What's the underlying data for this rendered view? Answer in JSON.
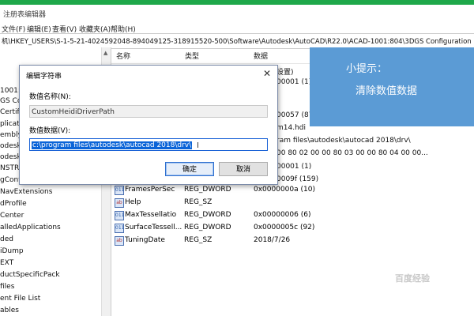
{
  "window": {
    "title": "注册表编辑器"
  },
  "menu": [
    "文件(F)",
    "编辑(E)",
    "查看(V)",
    "收藏夹(A)",
    "帮助(H)"
  ],
  "address": "机\\HKEY_USERS\\S-1-5-21-4024592048-894049125-318915520-500\\Software\\Autodesk\\AutoCAD\\R22.0\\ACAD-1001:804\\3DGS Configuration",
  "tree_items": [
    "1001:8",
    "GS Con",
    "Certific",
    "plicatio",
    "embly",
    "odeskA",
    "odeskS",
    "NSTRA",
    "gConve",
    "NavExtensions",
    "dProfile",
    "Center",
    "alledApplications",
    "ded",
    "iDump",
    "EXT",
    "ductSpecificPack",
    "files",
    "ent File List",
    "ables"
  ],
  "columns": {
    "name": "名称",
    "type": "类型",
    "data": "数据"
  },
  "peek_values": [
    "设置)",
    "00001 (1)",
    "00057 (87)",
    "m14.hdi",
    "ram files\\autodesk\\autocad 2018\\drv\\",
    "00 80 02 00 00 80 03 00 00 80 04 00 00...",
    "00001 (1)",
    "0009f (159)",
    "0000000a (10)"
  ],
  "rows": [
    {
      "icon": "dword-icon",
      "name": "FramesPerSec",
      "type": "REG_DWORD",
      "data": "0x0000000a (10)"
    },
    {
      "icon": "string-icon",
      "name": "Help",
      "type": "REG_SZ",
      "data": ""
    },
    {
      "icon": "dword-icon",
      "name": "MaxTessellatio",
      "type": "REG_DWORD",
      "data": "0x00000006 (6)"
    },
    {
      "icon": "dword-icon",
      "name": "SurfaceTessell...",
      "type": "REG_DWORD",
      "data": "0x0000005c (92)"
    },
    {
      "icon": "string-icon",
      "name": "TuningDate",
      "type": "REG_SZ",
      "data": "2018/7/26"
    }
  ],
  "dialog": {
    "title": "编辑字符串",
    "name_label": "数值名称(N):",
    "name_value": "CustomHeidiDriverPath",
    "data_label": "数值数据(V):",
    "data_value": "c:\\program files\\autodesk\\autocad 2018\\drv\\",
    "ok": "确定",
    "cancel": "取消"
  },
  "tip": {
    "line1": "小提示：",
    "line2": "清除数值数据"
  },
  "watermark": "百度经验",
  "colors": {
    "tip_bg": "#5b9bd5",
    "selection": "#0a64d8",
    "top_bar": "#1fa84a"
  }
}
